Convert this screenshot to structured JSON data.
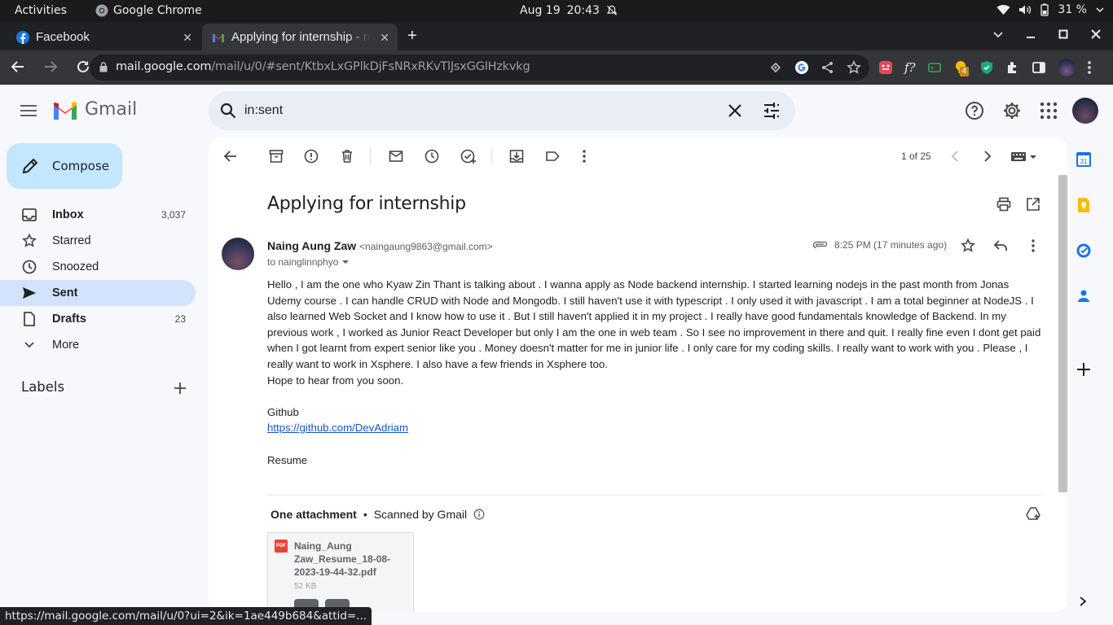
{
  "os": {
    "activities": "Activities",
    "app": "Google Chrome",
    "date": "Aug 19",
    "time": "20:43",
    "battery": "31 %"
  },
  "tabs": [
    {
      "title": "Facebook"
    },
    {
      "title": "Applying for internship - ng"
    }
  ],
  "browser": {
    "url_host": "mail.google.com",
    "url_path": "/mail/u/0/#sent/KtbxLxGPlkDjFsNRxRKvTlJsxGGlHzkvkg",
    "ext_badge": "4"
  },
  "gmail": {
    "logo_text": "Gmail",
    "search_value": "in:sent",
    "compose_label": "Compose",
    "nav": [
      {
        "label": "Inbox",
        "count": "3,037"
      },
      {
        "label": "Starred",
        "count": ""
      },
      {
        "label": "Snoozed",
        "count": ""
      },
      {
        "label": "Sent",
        "count": ""
      },
      {
        "label": "Drafts",
        "count": "23"
      },
      {
        "label": "More",
        "count": ""
      }
    ],
    "labels_header": "Labels"
  },
  "message": {
    "pager": "1 of 25",
    "subject": "Applying for internship",
    "sender_name": "Naing Aung Zaw",
    "sender_email": "<naingaung9863@gmail.com>",
    "to": "to nainglinnphyo",
    "time": "8:25 PM (17 minutes ago)",
    "body_paragraph": "Hello , I am the one who Kyaw Zin Thant is talking about . I wanna apply as Node backend internship. I started learning nodejs in the past month from Jonas Udemy course . I can handle CRUD with Node and Mongodb. I still haven't use it with typescript . I only used it with javascript . I am a total beginner at NodeJS . I also learned Web Socket and I know how to use it . But  I still haven't applied it in my project . I really have good fundamentals knowledge of Backend. In my previous work , I worked as Junior React Developer but only I am the one in web team . So I see no improvement in there and quit. I really fine even I dont get paid when I got learnt from expert senior like you . Money doesn't matter for me in junior life . I only care for my coding skills. I really want to work with you . Please , I really want to work in Xsphere. I also have a few friends in Xsphere too.",
    "hope_line": "Hope to hear from you soon.",
    "github_label": "Github",
    "github_link": "https://github.com/DevAdriam",
    "resume_label": "Resume",
    "attachment_header": "One attachment",
    "scanned_label": "Scanned by Gmail",
    "attachment_name": "Naing_Aung Zaw_Resume_18-08-2023-19-44-32.pdf",
    "attachment_size": "52 KB",
    "pdf_badge": "PDF"
  },
  "status_url": "https://mail.google.com/mail/u/0?ui=2&ik=1ae449b684&attid=..."
}
